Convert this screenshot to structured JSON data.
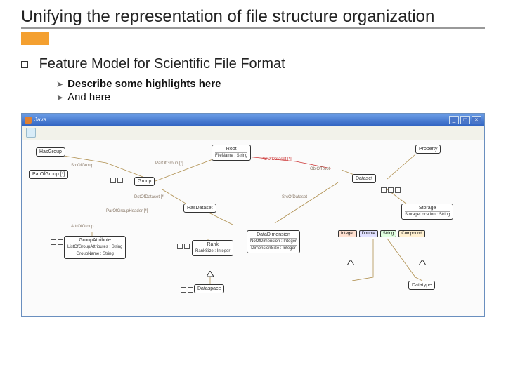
{
  "slide": {
    "title": "Unifying the representation of file structure organization",
    "feature_line": "Feature Model for Scientific File Format",
    "bullets": [
      "Describe some highlights here",
      "And here"
    ]
  },
  "window": {
    "app_title": "Java",
    "btn_min": "_",
    "btn_max": "□",
    "btn_close": "×"
  },
  "diagram": {
    "nodes": {
      "hasgroup": "HasGroup",
      "root": "Root",
      "filename": "FileName : String",
      "property": "Property",
      "parofgroup": "ParOfGroup [*]",
      "srcofgroup": "SrcOfGroup",
      "pardataset": "ParOfDataset  [*]",
      "objofroot": "ObjOfRoot",
      "dataset": "Dataset",
      "group": "Group",
      "dstofdataset": "DstOfDataset [*]",
      "hasdataset": "HasDataset",
      "srcofdataset": "SrcOfDataset",
      "storage": "Storage",
      "storageloc": "StorageLocation : String",
      "pargrpheader": "ParOfGroupHeader [*]",
      "attrofgroup": "AttrOfGroup",
      "groupattr": "GroupAttribute",
      "listattr": "ListOfGroupAttributes : String",
      "groupname": "GroupName : String",
      "rank": "Rank",
      "ranksize": "RankSize : Integer",
      "datadim": "DataDimension",
      "nodim": "NoOfDimension : Integer",
      "dimsize": "DimensionSize : Integer",
      "dataspace": "Dataspace",
      "datatype": "Datatype",
      "t_int": "Integer",
      "t_dbl": "Double",
      "t_str": "String",
      "t_cmp": "Compound"
    },
    "edge_labels": {
      "parofgroup": "ParOfGroup [*]",
      "srcofgroup": "SrcOfGroup",
      "dst": "DstOfDataset [*]",
      "parhdr": "ParOfGroupHeader [*]"
    }
  }
}
